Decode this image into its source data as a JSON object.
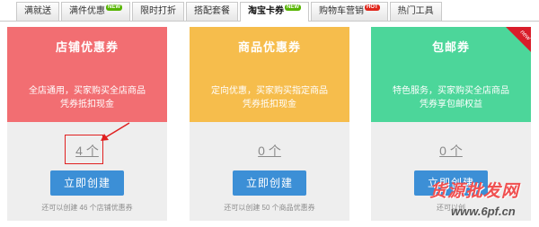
{
  "tabs": [
    {
      "label": "满就送",
      "badge": ""
    },
    {
      "label": "满件优惠",
      "badge": "NEW"
    },
    {
      "label": "限时打折",
      "badge": ""
    },
    {
      "label": "搭配套餐",
      "badge": ""
    },
    {
      "label": "淘宝卡券",
      "badge": "NEW",
      "active": true
    },
    {
      "label": "购物车营销",
      "badge": "HOT"
    },
    {
      "label": "热门工具",
      "badge": ""
    }
  ],
  "cards": [
    {
      "title": "店铺优惠券",
      "desc_line1": "全店通用，买家购买全店商品",
      "desc_line2": "凭券抵扣现金",
      "count": "4 个",
      "button_label": "立即创建",
      "footer": "还可以创建 46 个店铺优惠券",
      "color": "#f26e72"
    },
    {
      "title": "商品优惠券",
      "desc_line1": "定向优惠，买家购买指定商品",
      "desc_line2": "凭券抵扣现金",
      "count": "0 个",
      "button_label": "立即创建",
      "footer": "还可以创建 50 个商品优惠券",
      "color": "#f6bd4c"
    },
    {
      "title": "包邮券",
      "desc_line1": "特色服务，买家购买全店商品",
      "desc_line2": "凭券享包邮权益",
      "count": "0 个",
      "button_label": "立即创建",
      "footer": "还可以创",
      "color": "#4cd69a",
      "corner_label": "new"
    }
  ],
  "watermark": {
    "text": "货源批发网",
    "url": "www.6pf.cn"
  },
  "colors": {
    "button": "#3c8fd6",
    "highlight": "#e02020"
  }
}
